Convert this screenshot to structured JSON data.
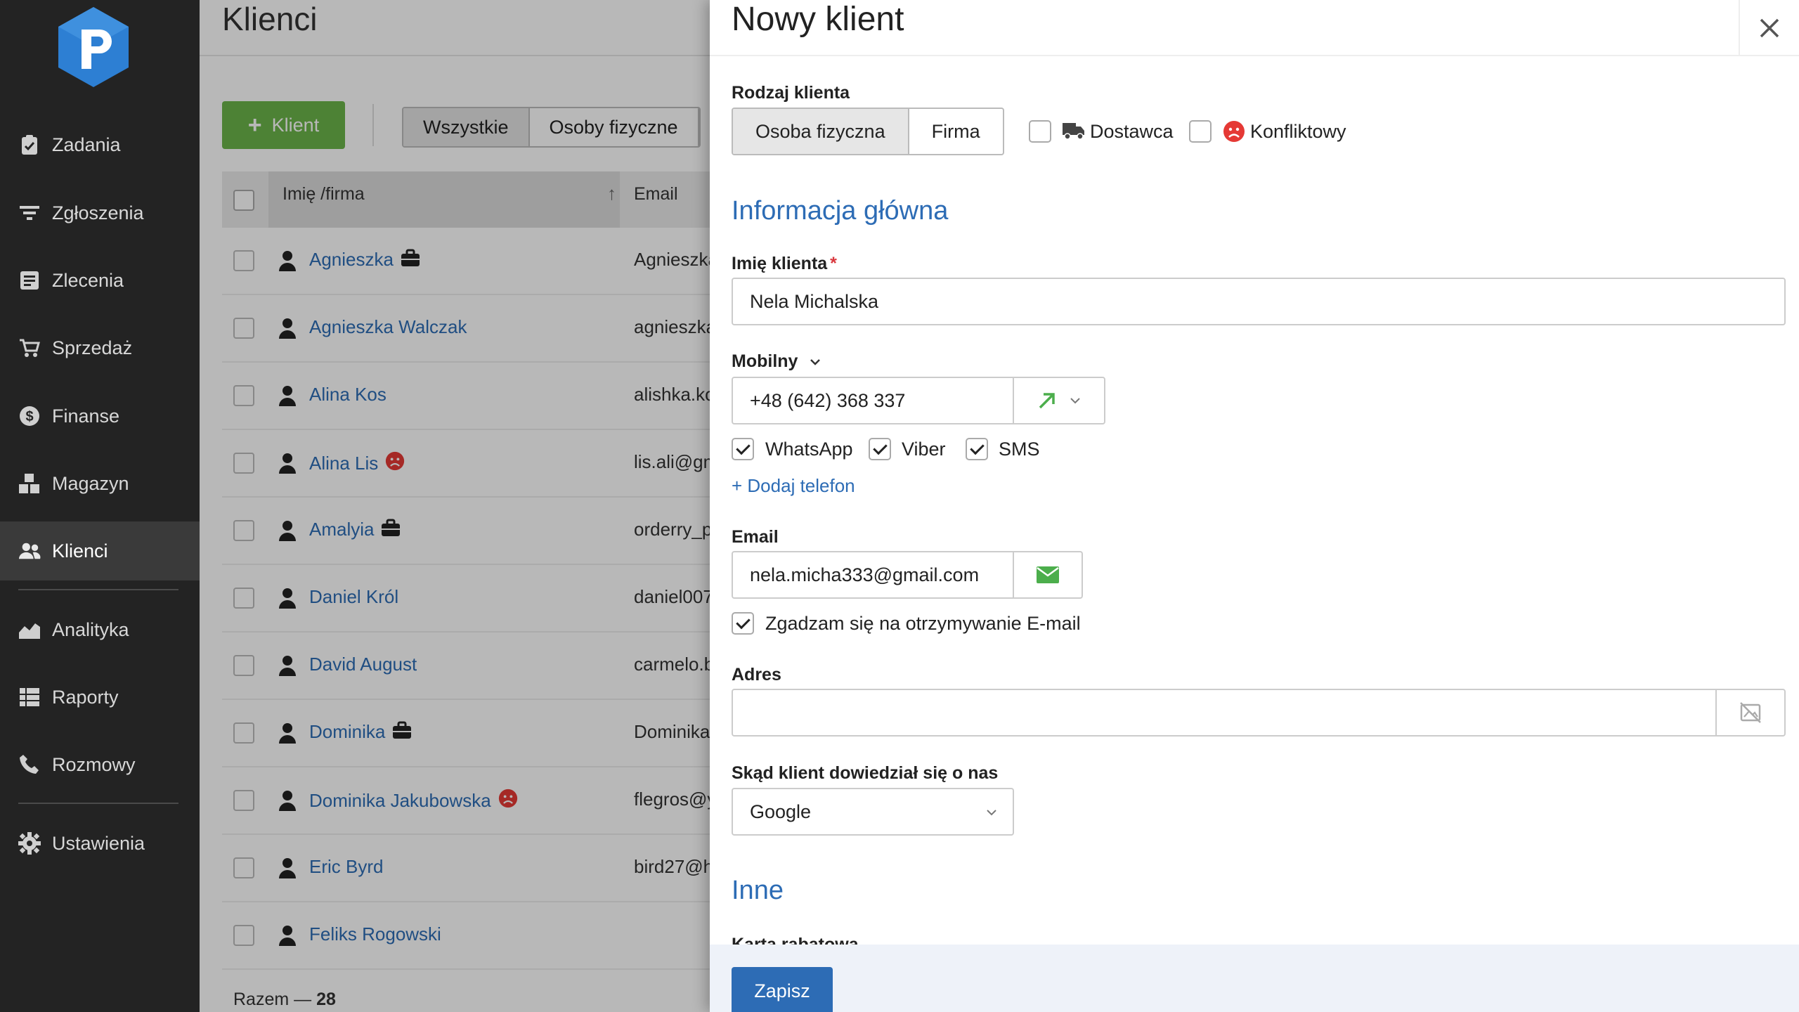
{
  "sidebar": {
    "items": [
      {
        "label": "Zadania",
        "icon": "clipboard-check-icon"
      },
      {
        "label": "Zgłoszenia",
        "icon": "filter-icon"
      },
      {
        "label": "Zlecenia",
        "icon": "order-list-icon"
      },
      {
        "label": "Sprzedaż",
        "icon": "cart-icon"
      },
      {
        "label": "Finanse",
        "icon": "dollar-icon"
      },
      {
        "label": "Magazyn",
        "icon": "boxes-icon"
      },
      {
        "label": "Klienci",
        "icon": "users-icon"
      },
      {
        "label": "Analityka",
        "icon": "area-chart-icon"
      },
      {
        "label": "Raporty",
        "icon": "table-icon"
      },
      {
        "label": "Rozmowy",
        "icon": "phone-icon"
      },
      {
        "label": "Ustawienia",
        "icon": "gear-icon"
      }
    ],
    "active": "Klienci"
  },
  "list": {
    "title": "Klienci",
    "add_button": "Klient",
    "filters": [
      "Wszystkie",
      "Osoby fizyczne"
    ],
    "columns": {
      "name": "Imię /firma",
      "email": "Email"
    },
    "rows": [
      {
        "name": "Agnieszka",
        "badge": "briefcase",
        "email": "Agnieszka"
      },
      {
        "name": "Agnieszka Walczak",
        "badge": "",
        "email": "agnieszka"
      },
      {
        "name": "Alina Kos",
        "badge": "",
        "email": "alishka.ko"
      },
      {
        "name": "Alina Lis",
        "badge": "conflict",
        "email": "lis.ali@gm"
      },
      {
        "name": "Amalyia",
        "badge": "briefcase",
        "email": "orderry_p"
      },
      {
        "name": "Daniel Król",
        "badge": "",
        "email": "daniel007"
      },
      {
        "name": "David August",
        "badge": "",
        "email": "carmelo.b"
      },
      {
        "name": "Dominika",
        "badge": "briefcase",
        "email": "Dominika"
      },
      {
        "name": "Dominika Jakubowska",
        "badge": "conflict",
        "email": "flegros@y"
      },
      {
        "name": "Eric Byrd",
        "badge": "",
        "email": "bird27@h"
      },
      {
        "name": "Feliks Rogowski",
        "badge": "",
        "email": ""
      }
    ],
    "total_label": "Razem —",
    "total_value": "28"
  },
  "panel": {
    "title": "Nowy klient",
    "client_type_label": "Rodzaj klienta",
    "client_type_options": [
      "Osoba fizyczna",
      "Firma"
    ],
    "client_type_selected": "Osoba fizyczna",
    "supplier_label": "Dostawca",
    "supplier_checked": false,
    "conflict_label": "Konfliktowy",
    "conflict_checked": false,
    "section_main": "Informacja główna",
    "name_label": "Imię klienta",
    "name_required_mark": "*",
    "name_value": "Nela Michalska",
    "phone_type_label": "Mobilny",
    "phone_value": "+48 (642) 368 337",
    "messengers": [
      {
        "label": "WhatsApp",
        "checked": true
      },
      {
        "label": "Viber",
        "checked": true
      },
      {
        "label": "SMS",
        "checked": true
      }
    ],
    "add_phone_link": "+ Dodaj telefon",
    "email_label": "Email",
    "email_value": "nela.micha333@gmail.com",
    "email_consent_label": "Zgadzam się na otrzymywanie E-mail",
    "email_consent_checked": true,
    "address_label": "Adres",
    "address_value": "",
    "source_label": "Skąd klient dowiedział się o nas",
    "source_value": "Google",
    "section_other": "Inne",
    "discount_card_label": "Karta rabatowa",
    "save_button": "Zapisz"
  },
  "colors": {
    "sidebar_bg": "#232323",
    "accent_blue": "#2d6cb5",
    "add_green": "#6bb44a",
    "conflict_red": "#e53935",
    "required_red": "#d9383e"
  }
}
